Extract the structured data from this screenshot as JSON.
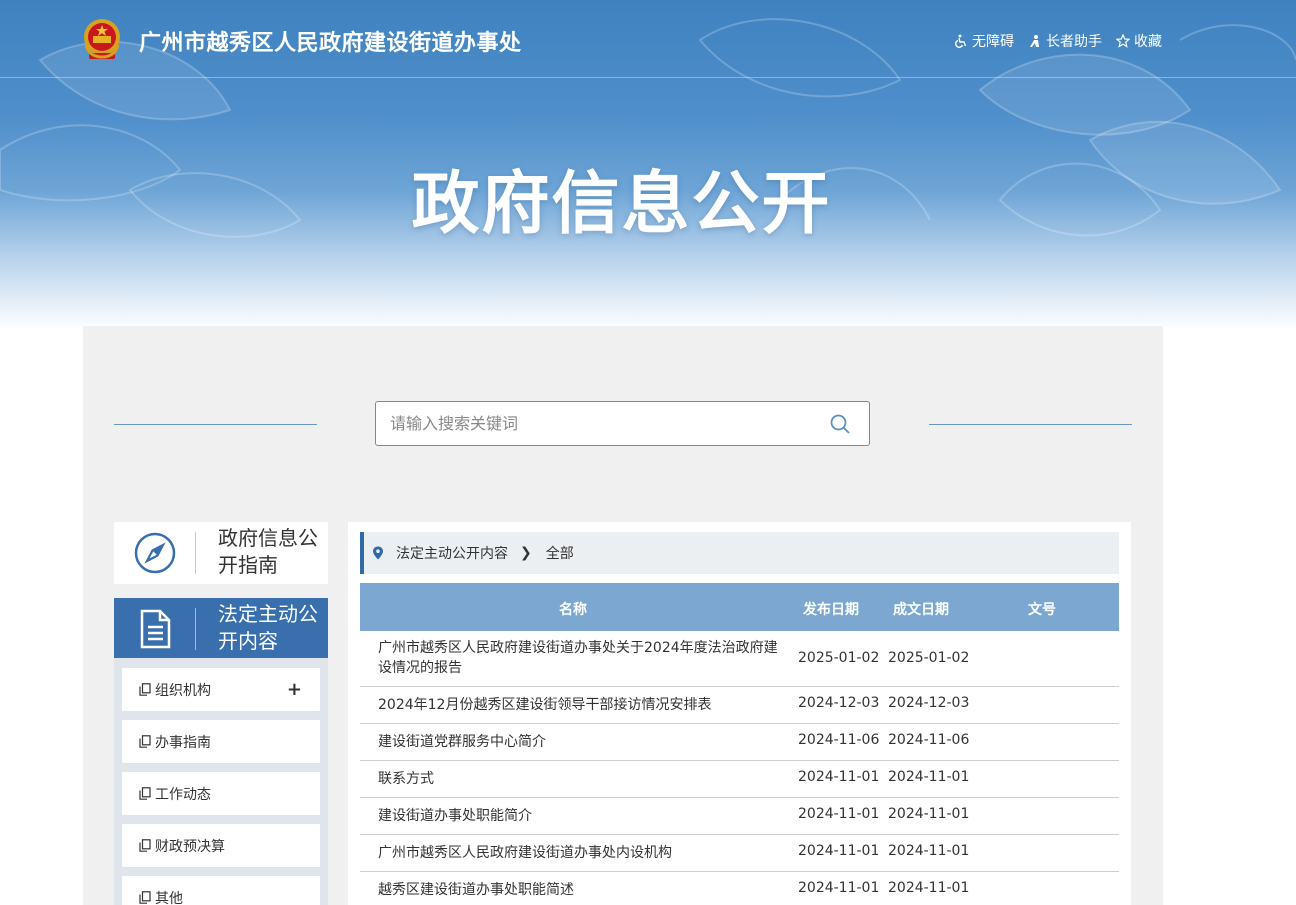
{
  "header": {
    "site_title": "广州市越秀区人民政府建设街道办事处",
    "tools": [
      "无障碍",
      "长者助手",
      "收藏"
    ],
    "page_heading": "政府信息公开"
  },
  "search": {
    "placeholder": "请输入搜索关键词"
  },
  "sidebar": {
    "guide_label": "政府信息公开指南",
    "statutory_label": "法定主动公开内容",
    "items": [
      "组织机构",
      "办事指南",
      "工作动态",
      "财政预决算",
      "其他"
    ]
  },
  "breadcrumb": {
    "section": "法定主动公开内容",
    "current": "全部"
  },
  "table": {
    "headers": [
      "名称",
      "发布日期",
      "成文日期",
      "文号"
    ],
    "rows": [
      {
        "name": "广州市越秀区人民政府建设街道办事处关于2024年度法治政府建设情况的报告",
        "published": "2025-01-02",
        "written": "2025-01-02",
        "doc_no": ""
      },
      {
        "name": "2024年12月份越秀区建设街领导干部接访情况安排表",
        "published": "2024-12-03",
        "written": "2024-12-03",
        "doc_no": ""
      },
      {
        "name": "建设街道党群服务中心简介",
        "published": "2024-11-06",
        "written": "2024-11-06",
        "doc_no": ""
      },
      {
        "name": "联系方式",
        "published": "2024-11-01",
        "written": "2024-11-01",
        "doc_no": ""
      },
      {
        "name": "建设街道办事处职能简介",
        "published": "2024-11-01",
        "written": "2024-11-01",
        "doc_no": ""
      },
      {
        "name": "广州市越秀区人民政府建设街道办事处内设机构",
        "published": "2024-11-01",
        "written": "2024-11-01",
        "doc_no": ""
      },
      {
        "name": "越秀区建设街道办事处职能简述",
        "published": "2024-11-01",
        "written": "2024-11-01",
        "doc_no": ""
      }
    ]
  },
  "colors": {
    "accent": "#3a6fae",
    "table_header": "#7ba7d1",
    "panel_bg": "#f0f0f0"
  }
}
